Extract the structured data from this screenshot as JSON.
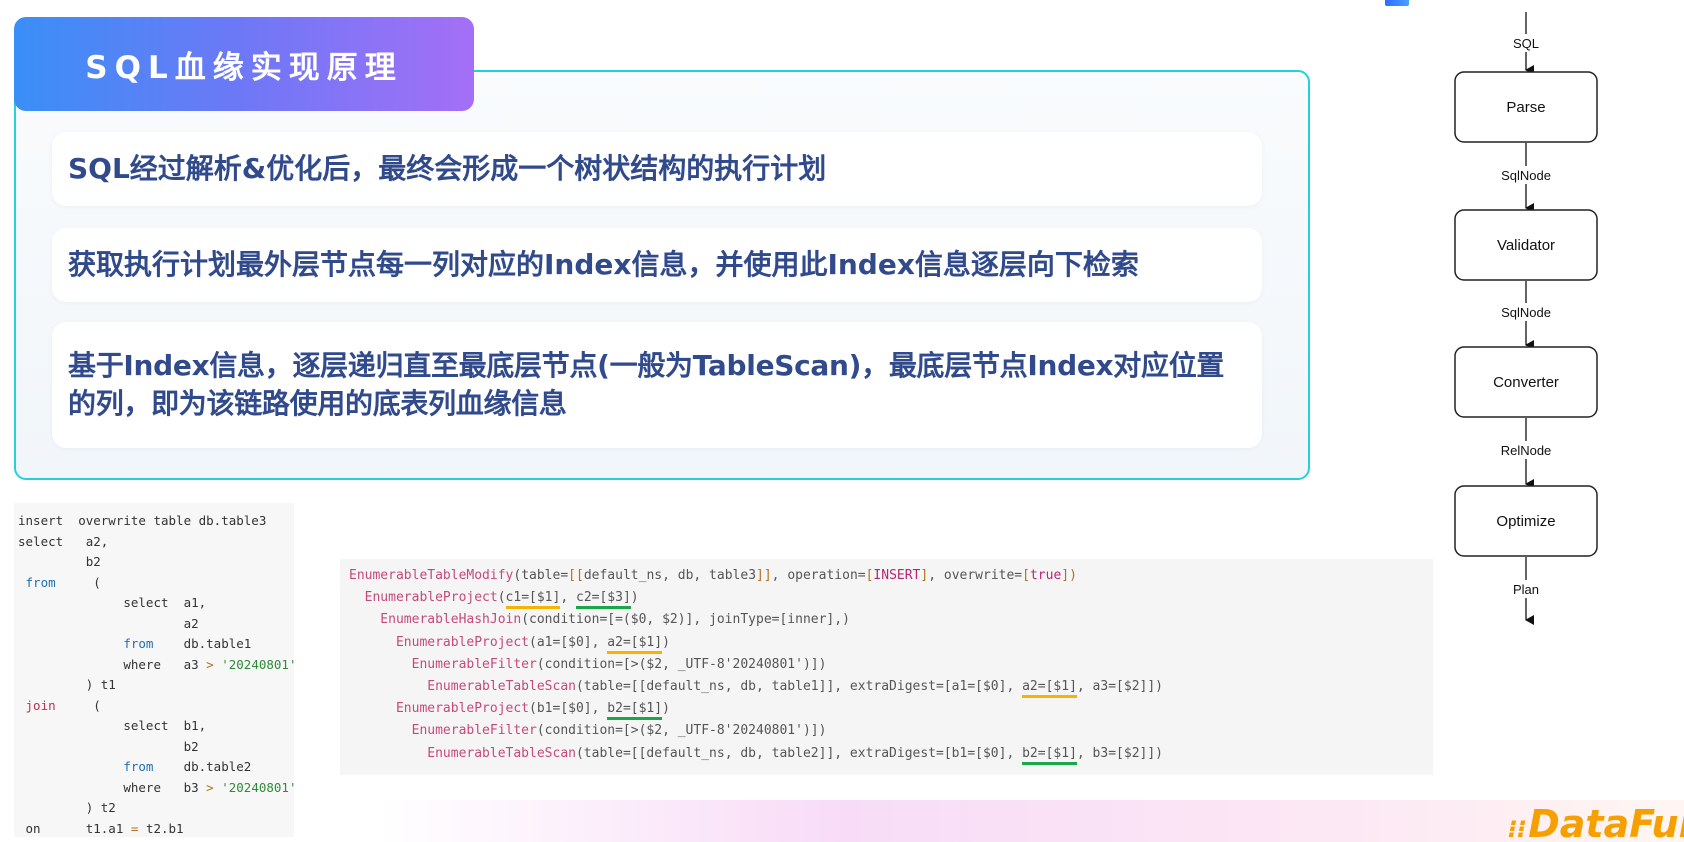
{
  "header": {
    "title": "SQL血缘实现原理",
    "corner_logo": ""
  },
  "points": [
    "SQL经过解析&优化后，最终会形成一个树状结构的执行计划",
    "获取执行计划最外层节点每一列对应的Index信息，并使用此Index信息逐层向下检索",
    "基于Index信息，逐层递归直至最底层节点(一般为TableScan)，最底层节点Index对应位置的列，即为该链路使用的底表列血缘信息"
  ],
  "sql_code": {
    "l1a": "insert",
    "l1b": "  overwrite table db.table3",
    "l2a": "select",
    "l2b": "   a2,",
    "l3": "         b2",
    "l4a": " from",
    "l4b": "     (",
    "l5": "              select  a1,",
    "l6": "                      a2",
    "l7a": "              from",
    "l7b": "    db.table1",
    "l8a": "              where   a3 ",
    "l8b": ">",
    "l8c": " '20240801'",
    "l9": "         ) t1",
    "l10a": " join",
    "l10b": "     (",
    "l11": "              select  b1,",
    "l12": "                      b2",
    "l13a": "              from",
    "l13b": "    db.table2",
    "l14a": "              where   b3 ",
    "l14b": ">",
    "l14c": " '20240801'",
    "l15": "         ) t2",
    "l16a": " on",
    "l16b": "      t1.a1 ",
    "l16c": "=",
    "l16d": " t2.b1"
  },
  "plan": {
    "p1_fn": "EnumerableTableModify",
    "p1_a": "(table=",
    "p1_b": "[[",
    "p1_c": "default_ns, db, table3",
    "p1_d": "]]",
    "p1_e": ", operation=",
    "p1_f": "[",
    "p1_g": "INSERT",
    "p1_h": "]",
    "p1_i": ", overwrite=",
    "p1_j": "[",
    "p1_k": "true",
    "p1_l": "])",
    "p2_fn": "  EnumerableProject",
    "p2_a": "(",
    "p2_b": "c1=[$1]",
    "p2_c": ", ",
    "p2_d": "c2=[$3]",
    "p2_e": ")",
    "p3_fn": "    EnumerableHashJoin",
    "p3_a": "(condition=[=($0, $2)], joinType=[inner],)",
    "p4_fn": "      EnumerableProject",
    "p4_a": "(a1=[$0], ",
    "p4_b": "a2=[$1]",
    "p4_c": ")",
    "p5_fn": "        EnumerableFilter",
    "p5_a": "(condition=[>($2, _UTF-8'20240801')])",
    "p6_fn": "          EnumerableTableScan",
    "p6_a": "(table=[[default_ns, db, table1]], extraDigest=[a1=[$0], ",
    "p6_b": "a2=[$1]",
    "p6_c": ", a3=[$2]])",
    "p7_fn": "      EnumerableProject",
    "p7_a": "(b1=[$0], ",
    "p7_b": "b2=[$1]",
    "p7_c": ")",
    "p8_fn": "        EnumerableFilter",
    "p8_a": "(condition=[>($2, _UTF-8'20240801')])",
    "p9_fn": "          EnumerableTableScan",
    "p9_a": "(table=[[default_ns, db, table2]], extraDigest=[b1=[$0], ",
    "p9_b": "b2=[$1]",
    "p9_c": ", b3=[$2]])"
  },
  "flow": {
    "nodes": [
      "Parse",
      "Validator",
      "Converter",
      "Optimize"
    ],
    "edges": [
      "SQL",
      "SqlNode",
      "SqlNode",
      "RelNode",
      "Plan"
    ]
  },
  "footer": {
    "logo_text": "DataFun."
  },
  "colors": {
    "accent_cyan": "#27d0d8",
    "title_gradient_start": "#3a8ff7",
    "title_gradient_end": "#a46ff6",
    "point_text": "#304a8c",
    "underline_orange": "#f5b400",
    "underline_green": "#18a848",
    "logo_orange": "#f5a000"
  }
}
